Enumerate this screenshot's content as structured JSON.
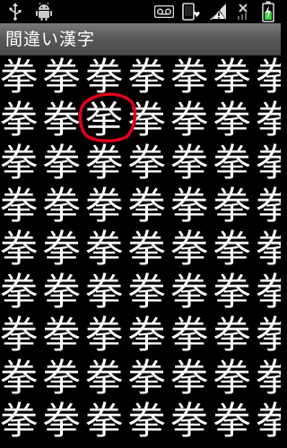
{
  "status_bar": {
    "icons": [
      "usb-icon",
      "android-debug-icon",
      "voicemail-icon",
      "phone-heart-icon",
      "signal-warning-icon",
      "no-signal-icon",
      "battery-charging-icon"
    ]
  },
  "title_bar": {
    "title": "間違い漢字"
  },
  "puzzle": {
    "common_char": "拳",
    "odd_char": "挙",
    "columns": 7,
    "rows": 9,
    "odd_row": 1,
    "odd_col": 2,
    "highlight_color": "#e0001b"
  }
}
